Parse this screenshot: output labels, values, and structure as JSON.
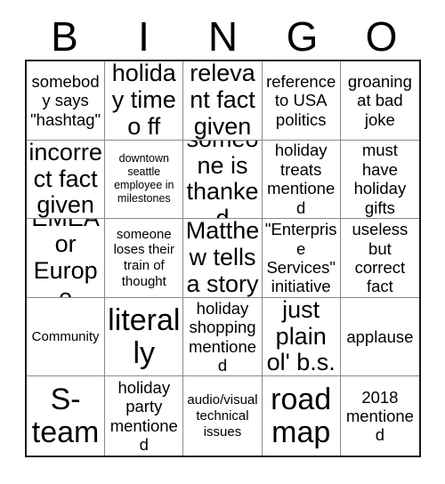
{
  "card": {
    "title_letters": [
      "B",
      "I",
      "N",
      "G",
      "O"
    ],
    "rows": [
      [
        {
          "text": "somebody says \"hashtag\"",
          "size": "fs-md"
        },
        {
          "text": "holiday time o ff",
          "size": "fs-xl"
        },
        {
          "text": "relevant fact given",
          "size": "fs-xl"
        },
        {
          "text": "reference to USA politics",
          "size": "fs-md"
        },
        {
          "text": "groaning at bad joke",
          "size": "fs-md"
        }
      ],
      [
        {
          "text": "incorrect fact given",
          "size": "fs-xl"
        },
        {
          "text": "downtown seattle employee in milestones",
          "size": "fs-xs"
        },
        {
          "text": "someone is thanked",
          "size": "fs-xl"
        },
        {
          "text": "holiday treats mentioned",
          "size": "fs-md"
        },
        {
          "text": "must have holiday gifts",
          "size": "fs-md"
        }
      ],
      [
        {
          "text": "EMEA or Europe",
          "size": "fs-xl"
        },
        {
          "text": "someone loses their train of thought",
          "size": "fs-sm"
        },
        {
          "text": "Matthew tells a story",
          "size": "fs-xl"
        },
        {
          "text": "\"Enterprise Services\" initiative",
          "size": "fs-md"
        },
        {
          "text": "useless but correct fact",
          "size": "fs-md"
        }
      ],
      [
        {
          "text": "Community",
          "size": "fs-sm"
        },
        {
          "text": "literally",
          "size": "fs-xxl"
        },
        {
          "text": "holiday shopping mentioned",
          "size": "fs-md"
        },
        {
          "text": "just plain ol' b.s.",
          "size": "fs-xl"
        },
        {
          "text": "applause",
          "size": "fs-md"
        }
      ],
      [
        {
          "text": "S- team",
          "size": "fs-xxl"
        },
        {
          "text": "holiday party mentioned",
          "size": "fs-md"
        },
        {
          "text": "audio/visual technical issues",
          "size": "fs-sm"
        },
        {
          "text": "road map",
          "size": "fs-xxl"
        },
        {
          "text": "2018 mentioned",
          "size": "fs-md"
        }
      ]
    ]
  }
}
